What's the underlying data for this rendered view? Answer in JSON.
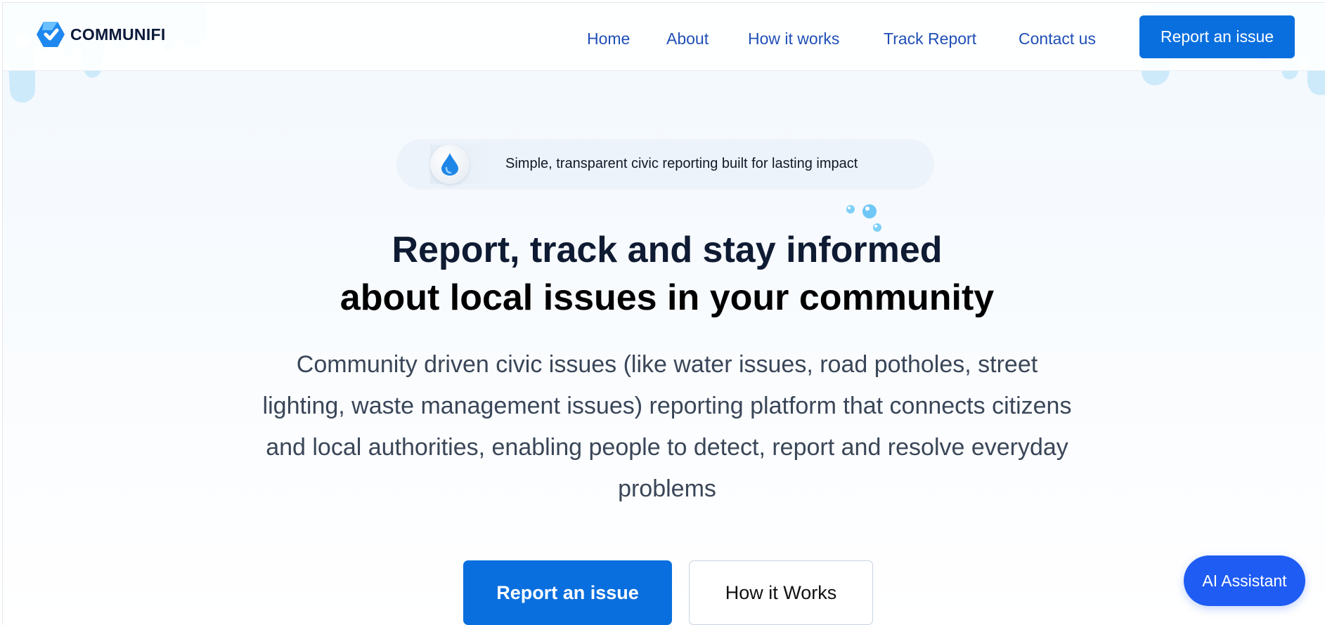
{
  "brand": {
    "name": "COMMUNIFI",
    "logo_icon": "communifi-logo-icon",
    "accent": "#0a6fde"
  },
  "nav": {
    "items": [
      {
        "label": "Home"
      },
      {
        "label": "About"
      },
      {
        "label": "How it works"
      },
      {
        "label": "Track Report"
      },
      {
        "label": "Contact us"
      }
    ],
    "cta_label": "Report an issue"
  },
  "hero": {
    "tagline": "Simple, transparent civic reporting built for lasting impact",
    "tagline_icon": "water-drop-icon",
    "headline_line1": "Report, track and stay informed",
    "headline_line2": "about local issues in your community",
    "description": "Community driven civic issues (like water issues, road potholes, street lighting, waste management issues) reporting platform that connects citizens and local authorities, enabling people to detect, report and resolve everyday problems",
    "primary_button": "Report an issue",
    "secondary_button": "How it Works"
  },
  "assistant": {
    "label": "AI Assistant",
    "color": "#1f5cf4"
  }
}
